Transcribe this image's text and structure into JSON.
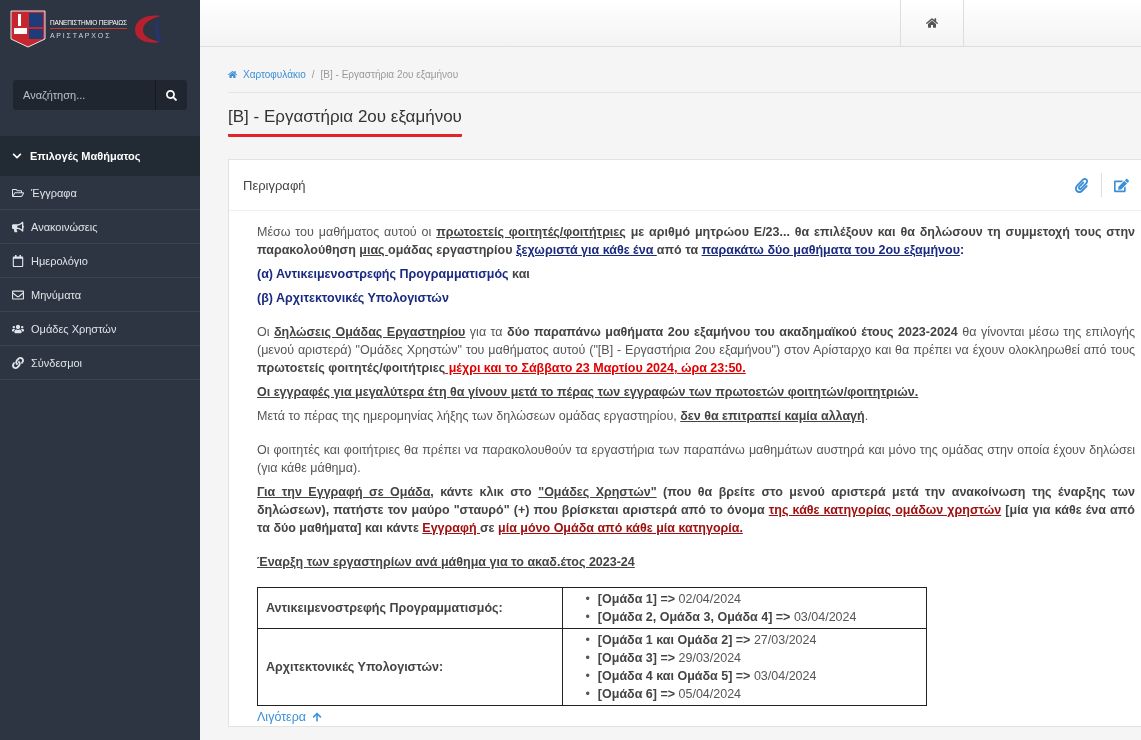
{
  "logo": {
    "university": "ΠΑΝΕΠΙΣΤΗΜΙΟ ΠΕΙΡΑΙΩΣ",
    "system": "Α Ρ Ι Σ Τ Α Ρ Χ Ο Σ"
  },
  "search": {
    "placeholder": "Αναζήτηση..."
  },
  "sidebar": {
    "section": {
      "label": "Επιλογές Μαθήματος",
      "expanded": true
    },
    "items": [
      {
        "label": "Έγγραφα"
      },
      {
        "label": "Ανακοινώσεις"
      },
      {
        "label": "Ημερολόγιο"
      },
      {
        "label": "Μηνύματα"
      },
      {
        "label": "Ομάδες Χρηστών"
      },
      {
        "label": "Σύνδεσμοι"
      }
    ]
  },
  "breadcrumb": {
    "separator": "/",
    "items": [
      {
        "label": "Χαρτοφυλάκιο",
        "link": true
      },
      {
        "label": "[Β] - Εργαστήρια 2ου εξαμήνου",
        "link": false
      }
    ]
  },
  "page_title": "[Β] - Εργαστήρια 2ου εξαμήνου",
  "card": {
    "title": "Περιγραφή",
    "blocks": [
      [
        {
          "segments": [
            {
              "text": "Μέσω του μαθήματος αυτού οι ",
              "kind": "plain"
            },
            {
              "text": "πρωτοετείς φοιτητές/φοιτήτριες",
              "kind": "strong_underlined"
            },
            {
              "text": " με αριθμό μητρώου Ε/23... θα επιλέξουν και θα δηλώσουν τη συμμετοχή τους στην παρακολούθηση ",
              "kind": "strong"
            },
            {
              "text": "μιας ",
              "kind": "strong_underlined"
            },
            {
              "text": "ομάδας εργαστηρίου ",
              "kind": "strong"
            },
            {
              "text": "ξεχωριστά για κάθε ένα ",
              "kind": "course_underlined"
            },
            {
              "text": "από τα ",
              "kind": "strong"
            },
            {
              "text": "παρακάτω δύο μαθήματα  του 2ου εξαμήνου",
              "kind": "course_underlined"
            },
            {
              "text": ":",
              "kind": "course"
            }
          ]
        },
        {
          "segments": [
            {
              "text": "(α) Αντικειμενοστρεφής Προγραμματισμός",
              "kind": "course"
            },
            {
              "text": " και",
              "kind": "strong"
            }
          ]
        },
        {
          "segments": [
            {
              "text": "(β) Αρχιτεκτονικές Υπολογιστών",
              "kind": "course"
            }
          ]
        }
      ],
      [
        {
          "segments": [
            {
              "text": "Οι ",
              "kind": "plain"
            },
            {
              "text": "δηλώσεις Ομάδας Εργαστηρίου",
              "kind": "strong_underlined"
            },
            {
              "text": " για τα ",
              "kind": "plain"
            },
            {
              "text": "δύο παραπάνω μαθήματα 2ου εξαμήνου του ακαδημαϊκού έτους 2023-2024",
              "kind": "strong"
            },
            {
              "text": " θα γίνονται μέσω της επιλογής (μενού αριστερά) \"Ομάδες Χρηστών\" του μαθήματος αυτού (\"[Β] - Εργαστήρια 2ου εξαμήνου\") στον Αρίσταρχο και θα πρέπει να έχουν ολοκληρωθεί από τους ",
              "kind": "plain"
            },
            {
              "text": "πρωτοετείς φοιτητές/φοιτήτριες",
              "kind": "strong"
            },
            {
              "text": " μέχρι και το Σάββατο 23 Μαρτίου 2024, ώρα 23:50.",
              "kind": "deadline"
            }
          ]
        },
        {
          "segments": [
            {
              "text": "Οι εγγραφές για μεγαλύτερα έτη θα γίνουν μετά το πέρας των εγγραφών των πρωτοετών φοιτητών/φοιτητριών.",
              "kind": "strong_underlined"
            }
          ]
        },
        {
          "segments": [
            {
              "text": "Μετά το πέρας της ημερομηνίας λήξης των δηλώσεων ομάδας εργαστηρίου, ",
              "kind": "plain"
            },
            {
              "text": "δεν θα επιτραπεί καμία αλλαγή",
              "kind": "strong_underlined"
            },
            {
              "text": ".",
              "kind": "plain"
            }
          ]
        }
      ],
      [
        {
          "segments": [
            {
              "text": "Οι φοιτητές και φοιτήτριες θα πρέπει να παρακολουθούν τα εργαστήρια των παραπάνω μαθημάτων αυστηρά και μόνο της ομάδας στην οποία έχουν δηλώσει (για κάθε μάθημα).",
              "kind": "plain"
            }
          ]
        },
        {
          "segments": [
            {
              "text": "Για την Εγγραφή σε Ομάδα",
              "kind": "strong_underlined"
            },
            {
              "text": ", κάντε κλικ στο ",
              "kind": "strong"
            },
            {
              "text": "\"Ομάδες Χρηστών\"",
              "kind": "strong_underlined"
            },
            {
              "text": " (που θα βρείτε στο μενού αριστερά μετά την ανακοίνωση της έναρξης των δηλώσεων), πατήστε τον μαύρο \"σταυρό\" (+) που βρίσκεται αριστερά από το όνομα ",
              "kind": "strong"
            },
            {
              "text": "της κάθε κατηγορίας ομάδων χρηστών",
              "kind": "warning_underlined"
            },
            {
              "text": " [μία για κάθε ένα από τα δύο μαθήματα] και κάντε ",
              "kind": "strong"
            },
            {
              "text": "Εγγραφή ",
              "kind": "warning_underlined"
            },
            {
              "text": "σε ",
              "kind": "strong"
            },
            {
              "text": "μία μόνο Ομάδα από κάθε μία κατηγορία.",
              "kind": "warning_underlined"
            }
          ]
        }
      ],
      [
        {
          "segments": [
            {
              "text": "Έναρξη των εργαστηρίων ανά μάθημα για το ακαδ.έτος 2023-24",
              "kind": "strong_underlined"
            }
          ]
        }
      ]
    ],
    "table": [
      {
        "course": "Αντικειμενοστρεφής Προγραμματισμός:",
        "items": [
          {
            "marker": "•",
            "group": "[Ομάδα 1] =>",
            "date": "02/04/2024"
          },
          {
            "marker": "•",
            "group": "[Ομάδα 2, Ομάδα 3, Ομάδα 4] =>",
            "date": "03/04/2024"
          }
        ]
      },
      {
        "course": "Αρχιτεκτονικές Υπολογιστών:",
        "items": [
          {
            "marker": "•",
            "group": "[Ομάδα 1 και Ομάδα 2] =>",
            "date": "27/03/2024"
          },
          {
            "marker": "•",
            "group": "[Ομάδα 3] =>",
            "date": "29/03/2024"
          },
          {
            "marker": "•",
            "group": "[Ομάδα 4 και Ομάδα 5] =>",
            "date": "03/04/2024"
          },
          {
            "marker": "•",
            "group": "[Ομάδα 6] =>",
            "date": "05/04/2024"
          }
        ]
      }
    ],
    "less_link": "Λιγότερα"
  }
}
